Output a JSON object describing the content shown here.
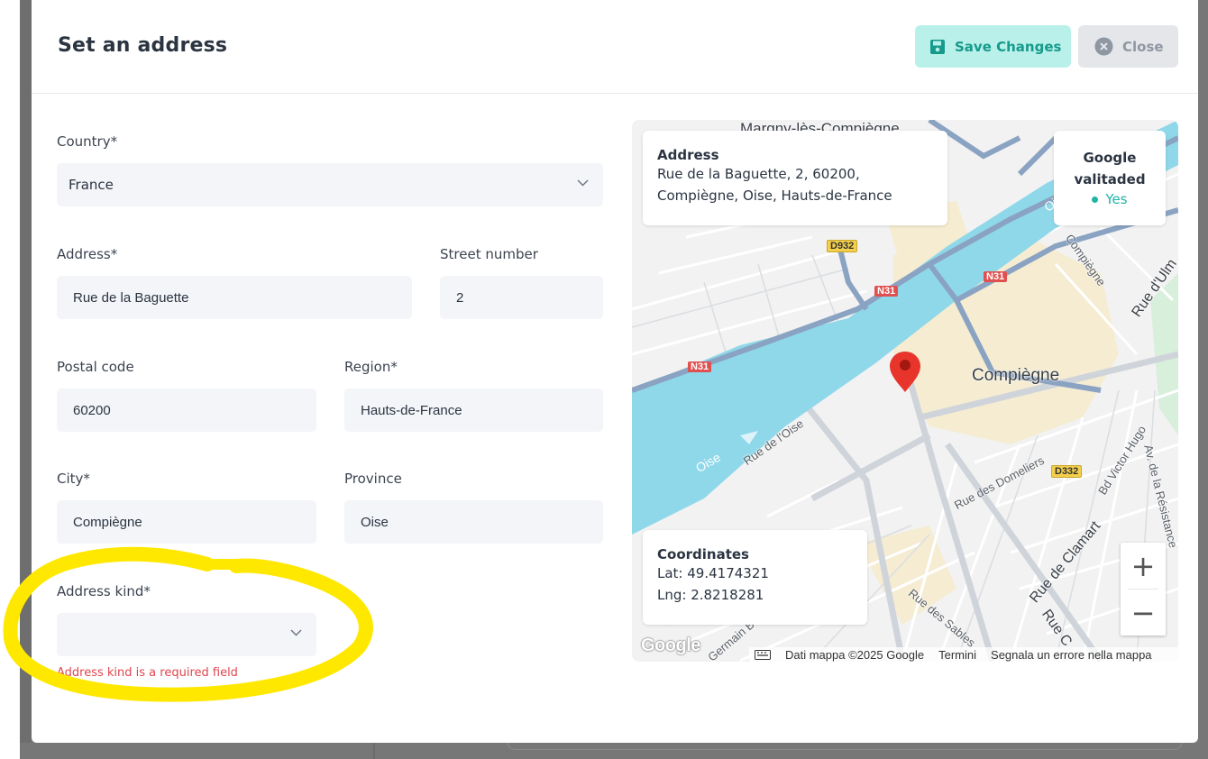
{
  "modal": {
    "title": "Set an address",
    "save_label": "Save Changes",
    "close_label": "Close"
  },
  "form": {
    "country": {
      "label": "Country*",
      "value": "France"
    },
    "address": {
      "label": "Address*",
      "value": "Rue de la Baguette"
    },
    "street_number": {
      "label": "Street number",
      "value": "2"
    },
    "postal_code": {
      "label": "Postal code",
      "value": "60200"
    },
    "region": {
      "label": "Region*",
      "value": "Hauts-de-France"
    },
    "city": {
      "label": "City*",
      "value": "Compiègne"
    },
    "province": {
      "label": "Province",
      "value": "Oise"
    },
    "address_kind": {
      "label": "Address kind*",
      "value": "",
      "error": "Address kind is a required field"
    }
  },
  "map": {
    "address_card": {
      "heading": "Address",
      "line1": "Rue de la Baguette, 2, 60200,",
      "line2": "Compiègne, Oise, Hauts-de-France"
    },
    "validated_card": {
      "heading_line1": "Google",
      "heading_line2": "valitaded",
      "status": "Yes"
    },
    "coordinates_card": {
      "heading": "Coordinates",
      "lat": "Lat: 49.4174321",
      "lng": "Lng: 2.8218281"
    },
    "zoom_in": "+",
    "zoom_out": "−",
    "logo": "Google",
    "attribution": {
      "data": "Dati mappa ©2025 Google",
      "terms": "Termini",
      "report": "Segnala un errore nella mappa"
    },
    "labels": {
      "city": "Compiègne",
      "top_town": "Margny-lès-Compiègne",
      "river1": "Oise",
      "river2": "Oise",
      "rue_oise": "Rue de l'Oise",
      "rue_domeliers": "Rue des Domeliers",
      "bd_hugo": "Bd Victor Hugo",
      "av_resistance": "Av. de la Résistance",
      "rue_clamart": "Rue de Clamart",
      "rue_ulm": "Rue d'Ulm",
      "compiegne_road": "Compiègne",
      "rue_sables": "Rue des Sables",
      "rue_c": "Rue C",
      "germain": "Germain Be",
      "shields": {
        "d932": "D932",
        "n31a": "N31",
        "n31b": "N31",
        "n31c": "N31",
        "d332": "D332"
      }
    },
    "colors": {
      "water": "#8fd8ea",
      "highway": "#8aa3c2",
      "urban": "#f5ecd2",
      "pin": "#e8352b"
    }
  },
  "colors": {
    "accent": "#159a8c",
    "save_bg": "#b9f0ea",
    "error": "#e0454d",
    "highlight": "#ffe800"
  }
}
